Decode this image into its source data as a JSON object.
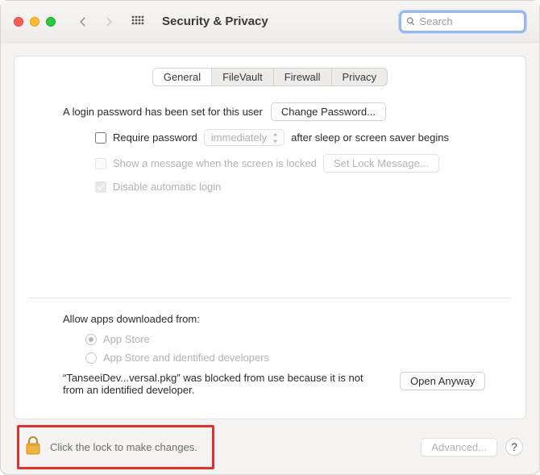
{
  "window": {
    "title": "Security & Privacy"
  },
  "search": {
    "placeholder": "Search"
  },
  "tabs": [
    "General",
    "FileVault",
    "Firewall",
    "Privacy"
  ],
  "active_tab": 0,
  "login_pw_text": "A login password has been set for this user",
  "change_pw_btn": "Change Password...",
  "require_pw_label": "Require password",
  "require_pw_delay": "immediately",
  "require_pw_suffix": "after sleep or screen saver begins",
  "show_msg_label": "Show a message when the screen is locked",
  "set_lock_btn": "Set Lock Message...",
  "disable_auto_login": "Disable automatic login",
  "allow_heading": "Allow apps downloaded from:",
  "radios": [
    "App Store",
    "App Store and identified developers"
  ],
  "selected_radio": 0,
  "blocked_text": "“TanseeiDev...versal.pkg” was blocked from use because it is not from an identified developer.",
  "open_anyway_btn": "Open Anyway",
  "lock_text": "Click the lock to make changes.",
  "advanced_btn": "Advanced...",
  "help_btn": "?"
}
